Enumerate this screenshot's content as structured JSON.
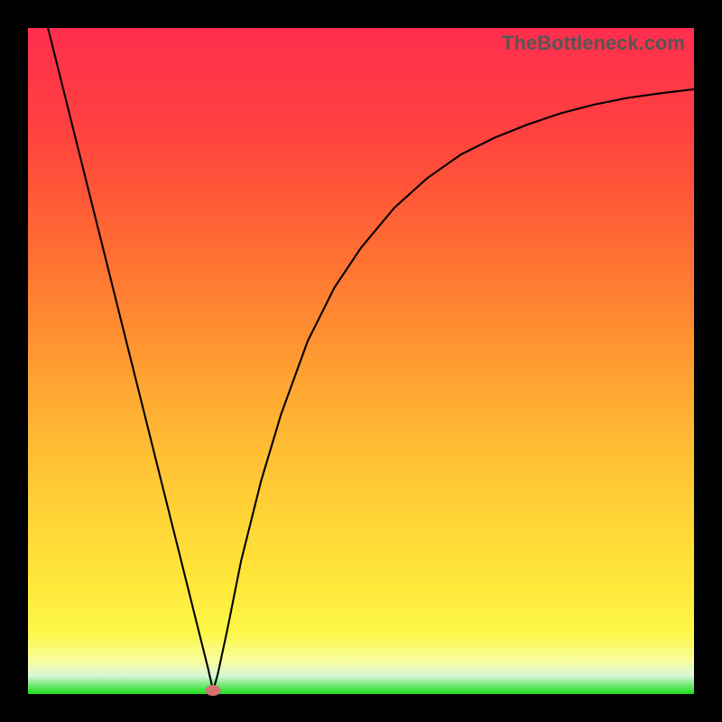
{
  "watermark": "TheBottleneck.com",
  "chart_data": {
    "type": "line",
    "title": "",
    "xlabel": "",
    "ylabel": "",
    "xlim": [
      0,
      100
    ],
    "ylim": [
      0,
      100
    ],
    "series": [
      {
        "name": "bottleneck-curve",
        "x": [
          3,
          5,
          8,
          11,
          14,
          17,
          20,
          23,
          25.5,
          27,
          27.8,
          28.5,
          30,
          32,
          35,
          38,
          42,
          46,
          50,
          55,
          60,
          65,
          70,
          75,
          80,
          85,
          90,
          95,
          100
        ],
        "values": [
          100,
          92,
          80,
          68,
          56,
          44,
          32,
          20,
          10,
          4,
          0.5,
          3,
          10,
          20,
          32,
          42,
          53,
          61,
          67,
          73,
          77.5,
          81,
          83.5,
          85.5,
          87.2,
          88.5,
          89.5,
          90.2,
          90.8
        ]
      }
    ],
    "annotations": [
      {
        "name": "minimum-marker",
        "x": 27.8,
        "y": 0.5
      }
    ],
    "background_gradient": {
      "type": "vertical",
      "stops": [
        {
          "pos": 0,
          "color": "#1cdf1c"
        },
        {
          "pos": 3,
          "color": "#d8f7d8"
        },
        {
          "pos": 10,
          "color": "#fdf84a"
        },
        {
          "pos": 30,
          "color": "#ffcd36"
        },
        {
          "pos": 50,
          "color": "#ff9832"
        },
        {
          "pos": 70,
          "color": "#ff6534"
        },
        {
          "pos": 100,
          "color": "#ff2e4e"
        }
      ]
    }
  }
}
